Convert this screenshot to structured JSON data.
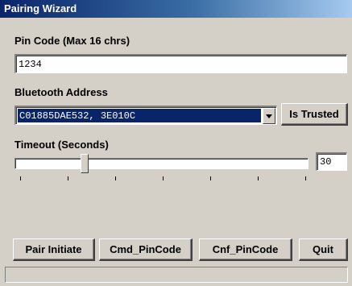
{
  "window": {
    "title": "Pairing Wizard"
  },
  "pin_code": {
    "label": "Pin Code (Max 16 chrs)",
    "value": "1234"
  },
  "bluetooth_address": {
    "label": "Bluetooth Address",
    "selected": "C01885DAE532, 3E010C",
    "is_trusted_label": "Is Trusted"
  },
  "timeout": {
    "label": "Timeout (Seconds)",
    "value": "30",
    "slider_min": 0,
    "slider_max": 300,
    "slider_value": 30,
    "tick_count": 7
  },
  "buttons": {
    "pair_initiate": "Pair Initiate",
    "cmd_pincode": "Cmd_PinCode",
    "cnf_pincode": "Cnf_PinCode",
    "quit": "Quit"
  },
  "status": {
    "text": ""
  },
  "colors": {
    "face": "#d4d0c8",
    "selection": "#0a246a",
    "title_start": "#0a246a",
    "title_end": "#a6caf0"
  },
  "icons": {
    "combo_arrow": "chevron-down-icon"
  }
}
